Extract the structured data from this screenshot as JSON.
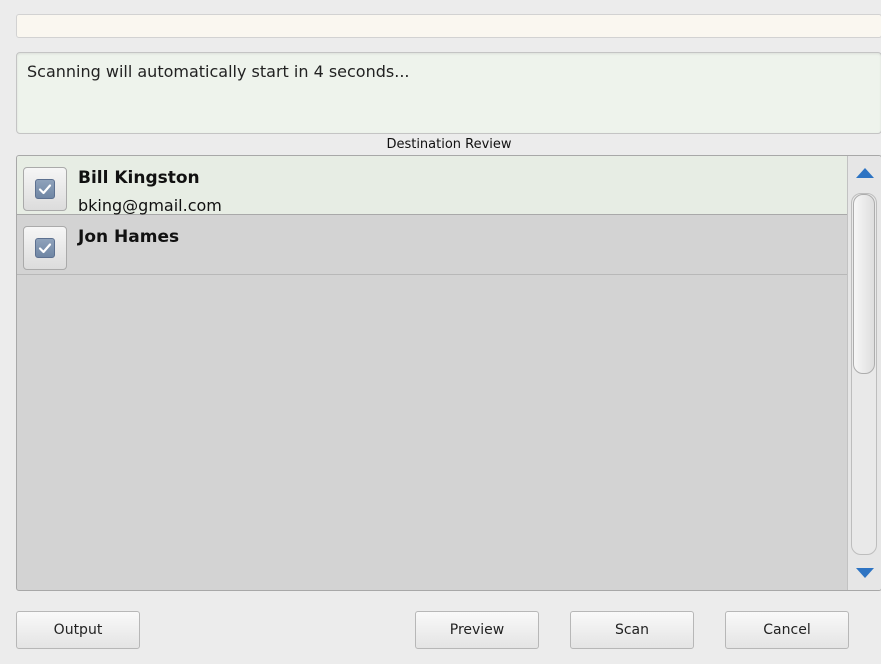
{
  "top_field": {
    "value": ""
  },
  "status": {
    "message": "Scanning will automatically start in 4 seconds..."
  },
  "section": {
    "title": "Destination Review"
  },
  "destinations": [
    {
      "name": "Bill Kingston",
      "email": "bking@gmail.com",
      "checked": true,
      "selected": true
    },
    {
      "name": "Jon Hames",
      "email": "",
      "checked": true,
      "selected": false
    }
  ],
  "scrollbar": {
    "up_icon": "triangle-up",
    "down_icon": "triangle-down",
    "accent_color": "#2e74c3"
  },
  "buttons": {
    "output": "Output",
    "preview": "Preview",
    "scan": "Scan",
    "cancel": "Cancel"
  },
  "colors": {
    "status_bg": "#eef3ec",
    "list_bg": "#d3d3d3",
    "selected_row_bg": "#e7ede4",
    "checkbox_fill": "#7a8fac"
  }
}
